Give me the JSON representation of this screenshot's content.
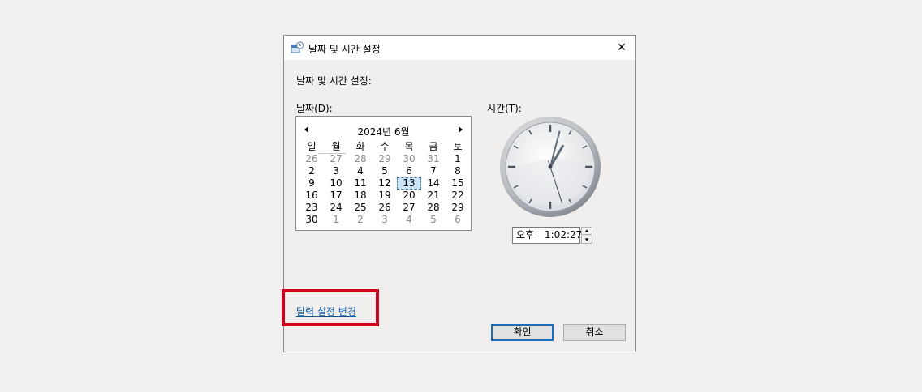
{
  "window": {
    "title": "날짜 및 시간 설정",
    "close_glyph": "✕"
  },
  "heading": "날짜 및 시간 설정:",
  "date_label": "날짜(D):",
  "time_label": "시간(T):",
  "calendar": {
    "month_title": "2024년 6월",
    "weekdays": [
      "일",
      "월",
      "화",
      "수",
      "목",
      "금",
      "토"
    ],
    "weeks": [
      [
        "26",
        "27",
        "28",
        "29",
        "30",
        "31",
        "1"
      ],
      [
        "2",
        "3",
        "4",
        "5",
        "6",
        "7",
        "8"
      ],
      [
        "9",
        "10",
        "11",
        "12",
        "13",
        "14",
        "15"
      ],
      [
        "16",
        "17",
        "18",
        "19",
        "20",
        "21",
        "22"
      ],
      [
        "23",
        "24",
        "25",
        "26",
        "27",
        "28",
        "29"
      ],
      [
        "30",
        "1",
        "2",
        "3",
        "4",
        "5",
        "6"
      ]
    ],
    "selected_day": "13"
  },
  "time": {
    "ampm": "오후",
    "value": "1:02:27",
    "hour": 1,
    "minute": 2,
    "second": 27
  },
  "link": "달력 설정 변경",
  "buttons": {
    "ok": "확인",
    "cancel": "취소"
  },
  "colors": {
    "link": "#0b5aa8",
    "highlight": "#d0021b",
    "selection": "#cce4f7",
    "ok_border": "#1c6fbd"
  }
}
